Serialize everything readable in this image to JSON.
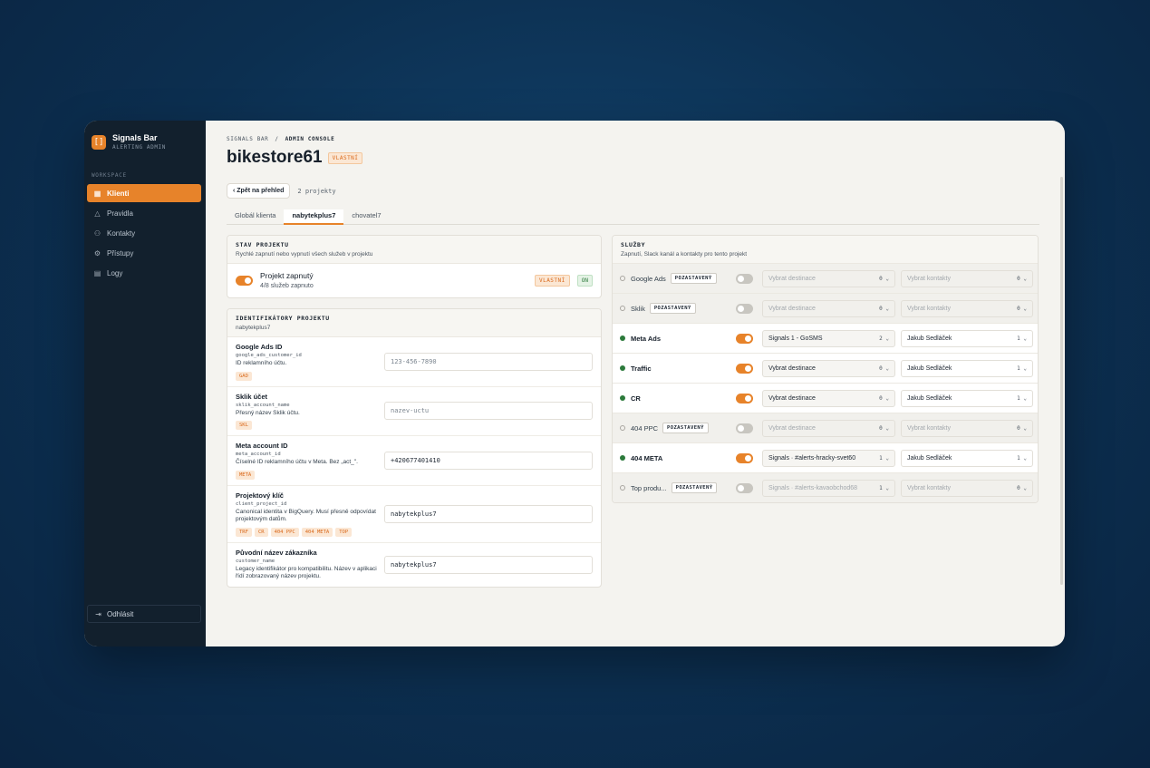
{
  "brand": {
    "title": "Signals Bar",
    "subtitle": "ALERTING ADMIN",
    "logo": "[]"
  },
  "sidebar": {
    "section": "WORKSPACE",
    "items": [
      {
        "label": "Klienti",
        "icon": "grid-icon",
        "active": true
      },
      {
        "label": "Pravidla",
        "icon": "warning-icon"
      },
      {
        "label": "Kontakty",
        "icon": "user-icon"
      },
      {
        "label": "Přístupy",
        "icon": "gear-icon"
      },
      {
        "label": "Logy",
        "icon": "document-icon"
      }
    ],
    "logout": "Odhlásit"
  },
  "header": {
    "crumb_root": "SIGNALS BAR",
    "crumb_sep": "/",
    "crumb_current": "ADMIN CONSOLE",
    "title": "bikestore61",
    "title_badge": "VLASTNÍ",
    "back_label": "Zpět na přehled",
    "project_count": "2 projekty"
  },
  "tabs": [
    "Globál klienta",
    "nabytekplus7",
    "chovatel7"
  ],
  "status_panel": {
    "heading": "STAV PROJEKTU",
    "desc": "Rychlé zapnutí nebo vypnutí všech služeb v projektu",
    "main": "Projekt zapnutý",
    "sub": "4/8 služeb zapnuto",
    "badge1": "VLASTNÍ",
    "badge2": "ON"
  },
  "ids_panel": {
    "heading": "IDENTIFIKÁTORY PROJEKTU",
    "desc": "nabytekplus7",
    "fields": [
      {
        "label": "Google Ads ID",
        "key": "google_ads_customer_id",
        "desc": "ID reklamního účtu.",
        "tags": [
          "GAD"
        ],
        "value": "123-456-7890",
        "placeholder": true
      },
      {
        "label": "Sklik účet",
        "key": "sklik_account_name",
        "desc": "Přesný název Sklik účtu.",
        "tags": [
          "SKL"
        ],
        "value": "nazev-uctu",
        "placeholder": true
      },
      {
        "label": "Meta account ID",
        "key": "meta_account_id",
        "desc": "Číselné ID reklamního účtu v Meta. Bez „act_\".",
        "tags": [
          "META"
        ],
        "value": "+420677401410",
        "placeholder": false
      },
      {
        "label": "Projektový klíč",
        "key": "client_project_id",
        "desc": "Canonical identita v BigQuery. Musí přesně odpovídat projektovým datům.",
        "tags": [
          "TRF",
          "CR",
          "404 PPC",
          "404 META",
          "TOP"
        ],
        "value": "nabytekplus7",
        "placeholder": false
      },
      {
        "label": "Původní název zákazníka",
        "key": "customer_name",
        "desc": "Legacy identifikátor pro kompatibilitu. Název v aplikaci řídí zobrazovaný název projektu.",
        "tags": [],
        "value": "nabytekplus7",
        "placeholder": false
      }
    ]
  },
  "services_panel": {
    "heading": "SLUŽBY",
    "desc": "Zapnutí, Slack kanál a kontakty pro tento projekt",
    "rows": [
      {
        "name": "Google Ads",
        "badge": "POZASTAVENÝ",
        "on": false,
        "dest": "Vybrat destinace",
        "dest_n": "0",
        "contact": "Vybrat kontakty",
        "contact_n": "0"
      },
      {
        "name": "Sklik",
        "badge": "POZASTAVENÝ",
        "on": false,
        "dest": "Vybrat destinace",
        "dest_n": "0",
        "contact": "Vybrat kontakty",
        "contact_n": "0"
      },
      {
        "name": "Meta Ads",
        "badge": "",
        "on": true,
        "dest": "Signals 1 - GoSMS",
        "dest_n": "2",
        "contact": "Jakub Sedláček",
        "contact_n": "1"
      },
      {
        "name": "Traffic",
        "badge": "",
        "on": true,
        "dest": "Vybrat destinace",
        "dest_n": "0",
        "contact": "Jakub Sedláček",
        "contact_n": "1"
      },
      {
        "name": "CR",
        "badge": "",
        "on": true,
        "dest": "Vybrat destinace",
        "dest_n": "0",
        "contact": "Jakub Sedláček",
        "contact_n": "1"
      },
      {
        "name": "404 PPC",
        "badge": "POZASTAVENÝ",
        "on": false,
        "dest": "Vybrat destinace",
        "dest_n": "0",
        "contact": "Vybrat kontakty",
        "contact_n": "0"
      },
      {
        "name": "404 META",
        "badge": "",
        "on": true,
        "dest": "Signals · #alerts-hracky-svet60",
        "dest_n": "1",
        "contact": "Jakub Sedláček",
        "contact_n": "1"
      },
      {
        "name": "Top produ...",
        "badge": "POZASTAVENÝ",
        "on": false,
        "dest": "Signals · #alerts-kavaobchod68",
        "dest_n": "1",
        "contact": "Vybrat kontakty",
        "contact_n": "0"
      }
    ]
  },
  "colors": {
    "accent": "#e7832a",
    "sidebar": "#12202d",
    "on": "#2c7a3b"
  }
}
